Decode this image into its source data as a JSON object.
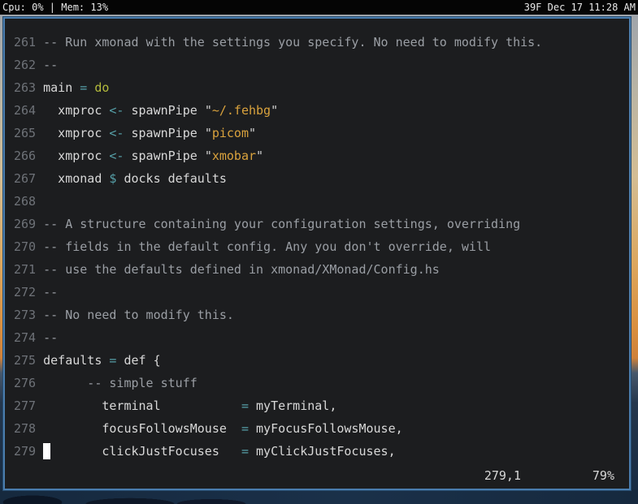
{
  "topbar": {
    "left": "Cpu: 0% | Mem: 13%",
    "right": "39F Dec 17 11:28 AM"
  },
  "editor": {
    "cursor": {
      "line": "279",
      "col": "1"
    },
    "ruler": {
      "position": "279,1",
      "percent": "79%"
    },
    "lines": [
      {
        "num": "261",
        "segs": [
          {
            "t": "-- Run xmonad with the settings you specify. No need to modify this.",
            "c": "comment"
          }
        ]
      },
      {
        "num": "262",
        "segs": [
          {
            "t": "--",
            "c": "comment"
          }
        ]
      },
      {
        "num": "263",
        "segs": [
          {
            "t": "main ",
            "c": "plain"
          },
          {
            "t": "=",
            "c": "op"
          },
          {
            "t": " ",
            "c": "plain"
          },
          {
            "t": "do",
            "c": "keyword"
          }
        ]
      },
      {
        "num": "264",
        "segs": [
          {
            "t": "  xmproc ",
            "c": "plain"
          },
          {
            "t": "<-",
            "c": "op"
          },
          {
            "t": " spawnPipe ",
            "c": "plain"
          },
          {
            "t": "\"",
            "c": "quote"
          },
          {
            "t": "~/.fehbg",
            "c": "string"
          },
          {
            "t": "\"",
            "c": "quote"
          }
        ]
      },
      {
        "num": "265",
        "segs": [
          {
            "t": "  xmproc ",
            "c": "plain"
          },
          {
            "t": "<-",
            "c": "op"
          },
          {
            "t": " spawnPipe ",
            "c": "plain"
          },
          {
            "t": "\"",
            "c": "quote"
          },
          {
            "t": "picom",
            "c": "string"
          },
          {
            "t": "\"",
            "c": "quote"
          }
        ]
      },
      {
        "num": "266",
        "segs": [
          {
            "t": "  xmproc ",
            "c": "plain"
          },
          {
            "t": "<-",
            "c": "op"
          },
          {
            "t": " spawnPipe ",
            "c": "plain"
          },
          {
            "t": "\"",
            "c": "quote"
          },
          {
            "t": "xmobar",
            "c": "string"
          },
          {
            "t": "\"",
            "c": "quote"
          }
        ]
      },
      {
        "num": "267",
        "segs": [
          {
            "t": "  xmonad ",
            "c": "plain"
          },
          {
            "t": "$",
            "c": "op"
          },
          {
            "t": " docks defaults",
            "c": "plain"
          }
        ]
      },
      {
        "num": "268",
        "segs": []
      },
      {
        "num": "269",
        "segs": [
          {
            "t": "-- A structure containing your configuration settings, overriding",
            "c": "comment"
          }
        ]
      },
      {
        "num": "270",
        "segs": [
          {
            "t": "-- fields in the default config. Any you don't override, will",
            "c": "comment"
          }
        ]
      },
      {
        "num": "271",
        "segs": [
          {
            "t": "-- use the defaults defined in xmonad/XMonad/Config.hs",
            "c": "comment"
          }
        ]
      },
      {
        "num": "272",
        "segs": [
          {
            "t": "--",
            "c": "comment"
          }
        ]
      },
      {
        "num": "273",
        "segs": [
          {
            "t": "-- No need to modify this.",
            "c": "comment"
          }
        ]
      },
      {
        "num": "274",
        "segs": [
          {
            "t": "--",
            "c": "comment"
          }
        ]
      },
      {
        "num": "275",
        "segs": [
          {
            "t": "defaults ",
            "c": "plain"
          },
          {
            "t": "=",
            "c": "op"
          },
          {
            "t": " def {",
            "c": "plain"
          }
        ]
      },
      {
        "num": "276",
        "segs": [
          {
            "t": "      -- simple stuff",
            "c": "comment"
          }
        ]
      },
      {
        "num": "277",
        "segs": [
          {
            "t": "        terminal           ",
            "c": "plain"
          },
          {
            "t": "=",
            "c": "op"
          },
          {
            "t": " myTerminal,",
            "c": "plain"
          }
        ]
      },
      {
        "num": "278",
        "segs": [
          {
            "t": "        focusFollowsMouse  ",
            "c": "plain"
          },
          {
            "t": "=",
            "c": "op"
          },
          {
            "t": " myFocusFollowsMouse,",
            "c": "plain"
          }
        ]
      },
      {
        "num": "279",
        "segs": [
          {
            "t": "        clickJustFocuses   ",
            "c": "plain"
          },
          {
            "t": "=",
            "c": "op"
          },
          {
            "t": " myClickJustFocuses,",
            "c": "plain"
          }
        ]
      }
    ]
  },
  "colors": {
    "topbar_bg": "#050505",
    "topbar_text": "#e8e8e8",
    "window_border": "#4a7dae",
    "terminal_bg": "#1c1d1f",
    "text": "#d8d8d8",
    "line_number": "#6e7278",
    "comment": "#9a9ea4",
    "operator": "#56a0a8",
    "keyword": "#b4bb3c",
    "string": "#d9a23d",
    "cursor": "#ffffff"
  }
}
